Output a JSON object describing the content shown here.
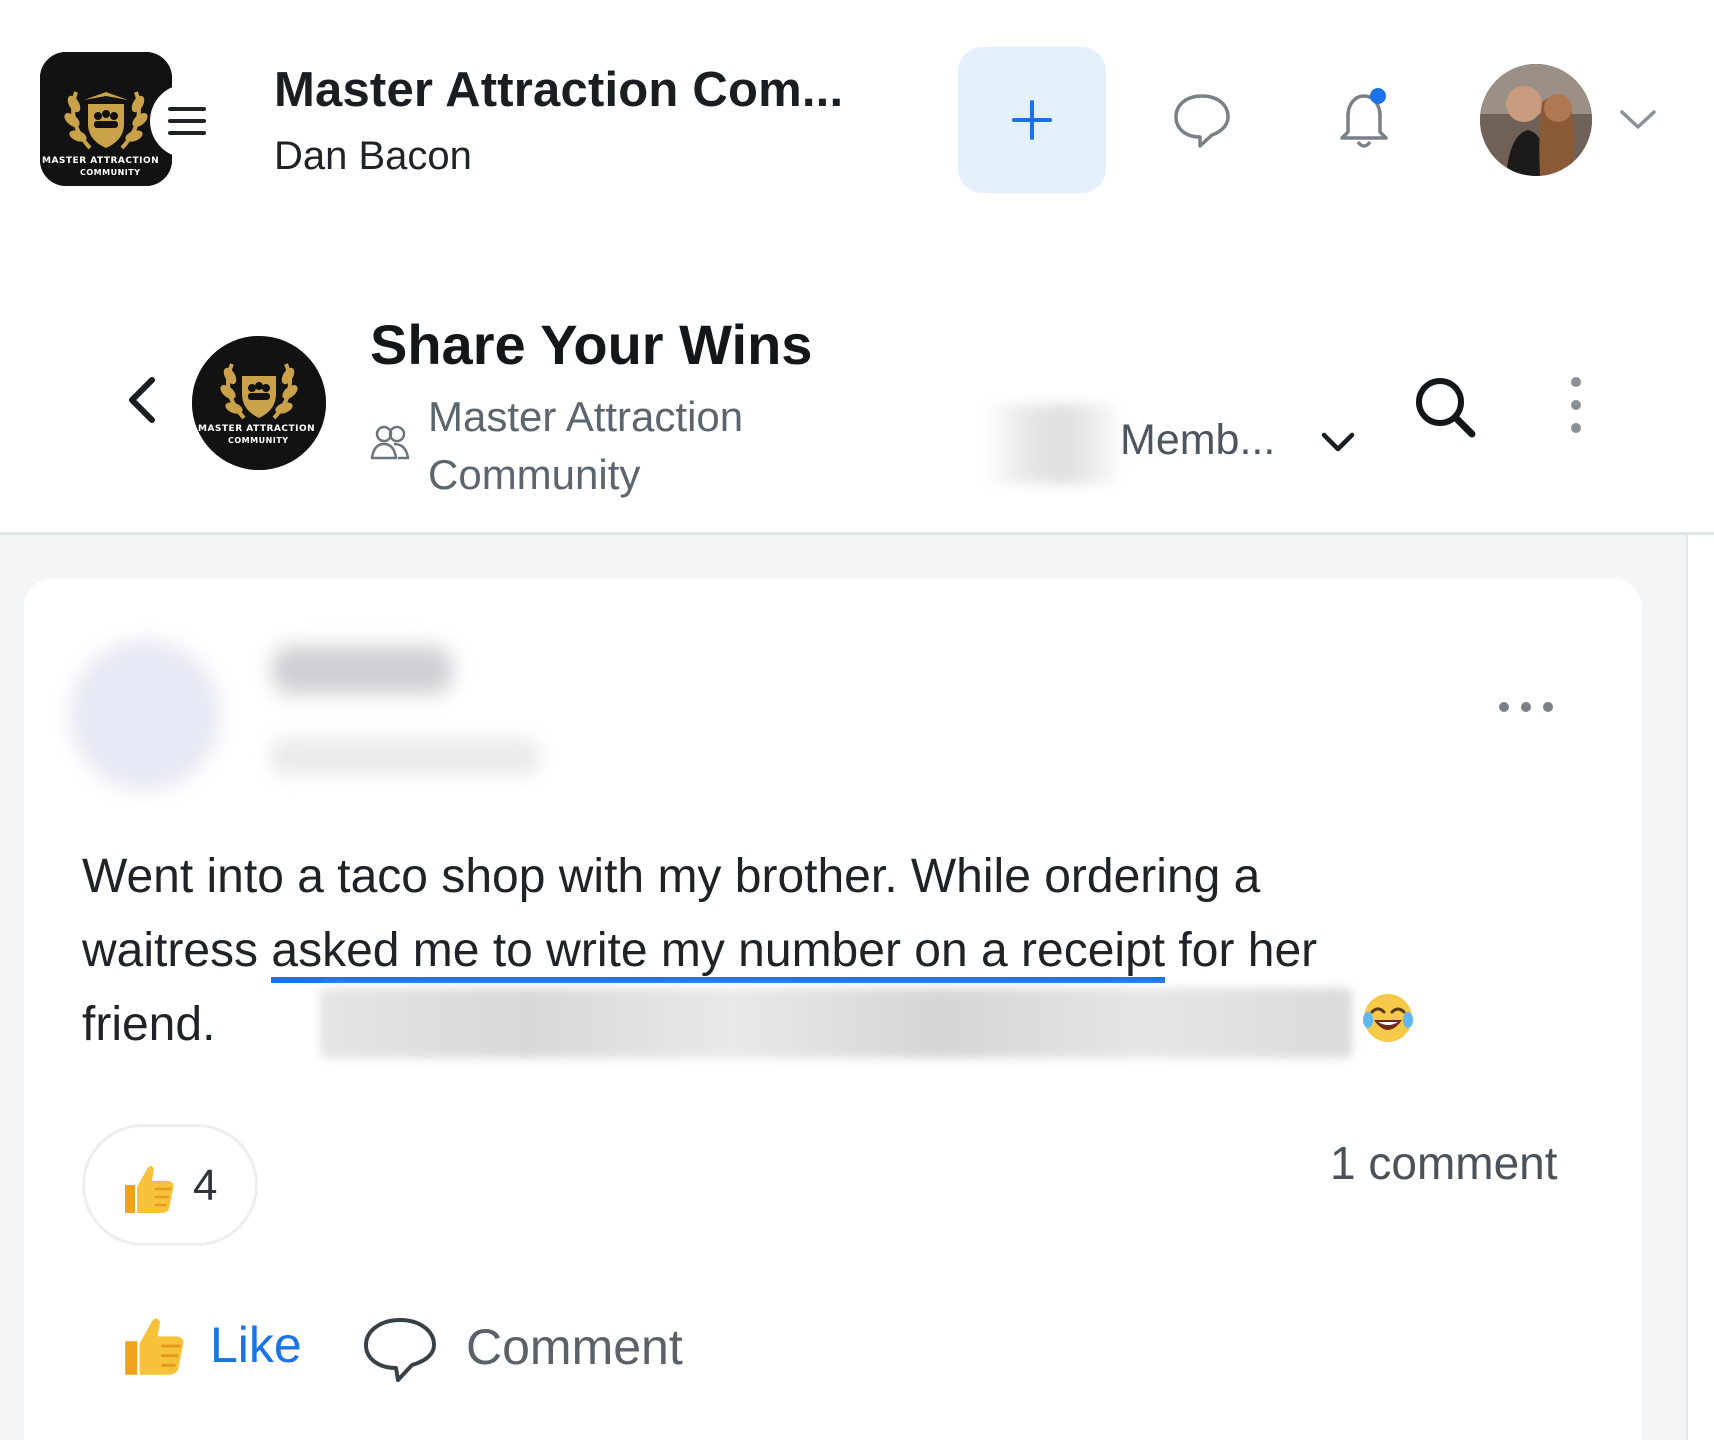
{
  "header": {
    "community_name": "Master Attraction Com...",
    "owner_name": "Dan Bacon",
    "logo_text": "MASTER ATTRACTION",
    "logo_text2": "COMMUNITY",
    "icons": [
      "menu-icon",
      "plus-icon",
      "chat-icon",
      "bell-icon",
      "chevron-down-icon"
    ],
    "notification_dot_color": "#1a73e8"
  },
  "space": {
    "title": "Share Your Wins",
    "community_line1": "Master Attraction",
    "community_line2": "Community",
    "members_label": "Memb...",
    "logo_text": "MASTER ATTRACTION",
    "logo_text2": "COMMUNITY",
    "icons": [
      "back-chevron-icon",
      "group-icon",
      "chevron-down-icon",
      "search-icon",
      "more-vertical-icon"
    ]
  },
  "post": {
    "line1": "Went into a taco shop with my brother. While ordering a",
    "line2_before": "waitress ",
    "line2_highlight": "asked me to write my number on a receipt",
    "line2_after": " for her",
    "line3": "friend.",
    "emoji": "face-with-tears-of-joy",
    "reaction_count": "4",
    "comment_count": "1 comment",
    "like_label": "Like",
    "comment_label": "Comment",
    "accent_color": "#1a73e8"
  }
}
